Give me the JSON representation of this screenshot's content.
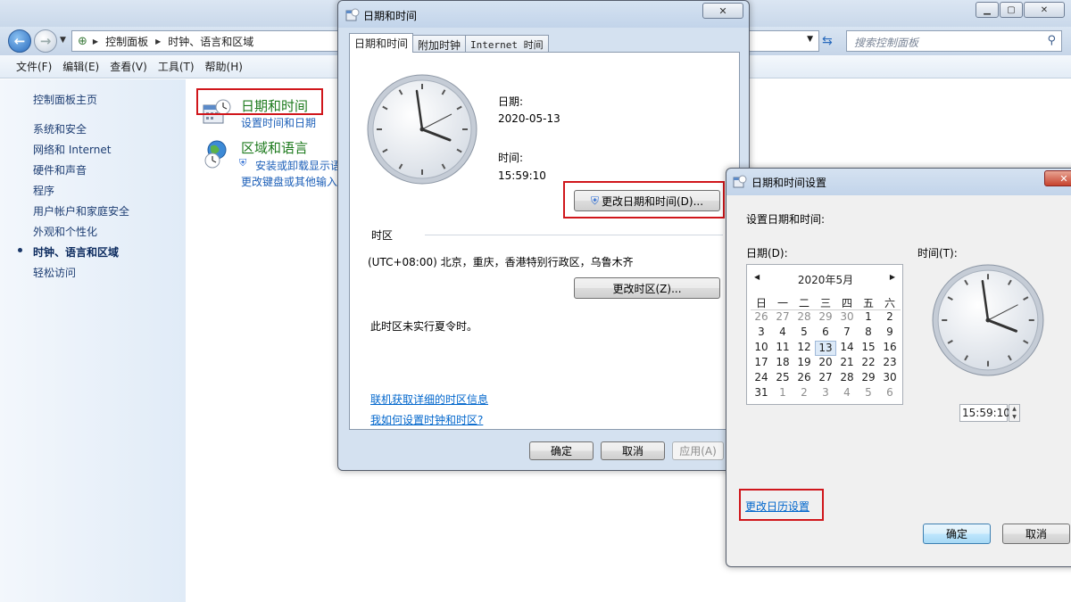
{
  "control_panel": {
    "address": [
      "控制面板",
      "时钟、语言和区域"
    ],
    "search_placeholder": "搜索控制面板",
    "menu": [
      "文件(F)",
      "编辑(E)",
      "查看(V)",
      "工具(T)",
      "帮助(H)"
    ],
    "sidebar": {
      "home": "控制面板主页",
      "items": [
        "系统和安全",
        "网络和 Internet",
        "硬件和声音",
        "程序",
        "用户帐户和家庭安全",
        "外观和个性化",
        "时钟、语言和区域",
        "轻松访问"
      ],
      "active_index": 6
    },
    "categories": [
      {
        "title": "日期和时间",
        "links": [
          "设置时间和日期"
        ]
      },
      {
        "title": "区域和语言",
        "links": [
          "安装或卸载显示语",
          "更改键盘或其他输入"
        ]
      }
    ]
  },
  "datetime_dialog": {
    "title": "日期和时间",
    "tabs": [
      "日期和时间",
      "附加时钟",
      "Internet 时间"
    ],
    "date_label": "日期:",
    "date_value": "2020-05-13",
    "time_label": "时间:",
    "time_value": "15:59:10",
    "change_datetime_button": "更改日期和时间(D)...",
    "timezone_section": "时区",
    "timezone_value": "(UTC+08:00) 北京，重庆，香港特别行政区，乌鲁木齐",
    "change_timezone_button": "更改时区(Z)...",
    "dst_note": "此时区未实行夏令时。",
    "link_tz_info": "联机获取详细的时区信息",
    "link_howto": "我如何设置时钟和时区?",
    "ok": "确定",
    "cancel": "取消",
    "apply": "应用(A)"
  },
  "settings_dialog": {
    "title": "日期和时间设置",
    "heading": "设置日期和时间:",
    "date_label": "日期(D):",
    "time_label": "时间(T):",
    "calendar": {
      "month": "2020年5月",
      "weekdays": [
        "日",
        "一",
        "二",
        "三",
        "四",
        "五",
        "六"
      ],
      "weeks": [
        [
          "26",
          "27",
          "28",
          "29",
          "30",
          "1",
          "2"
        ],
        [
          "3",
          "4",
          "5",
          "6",
          "7",
          "8",
          "9"
        ],
        [
          "10",
          "11",
          "12",
          "13",
          "14",
          "15",
          "16"
        ],
        [
          "17",
          "18",
          "19",
          "20",
          "21",
          "22",
          "23"
        ],
        [
          "24",
          "25",
          "26",
          "27",
          "28",
          "29",
          "30"
        ],
        [
          "31",
          "1",
          "2",
          "3",
          "4",
          "5",
          "6"
        ]
      ],
      "selected": "13"
    },
    "time_value": "15:59:10",
    "calendar_settings_link": "更改日历设置",
    "ok": "确定",
    "cancel": "取消"
  }
}
